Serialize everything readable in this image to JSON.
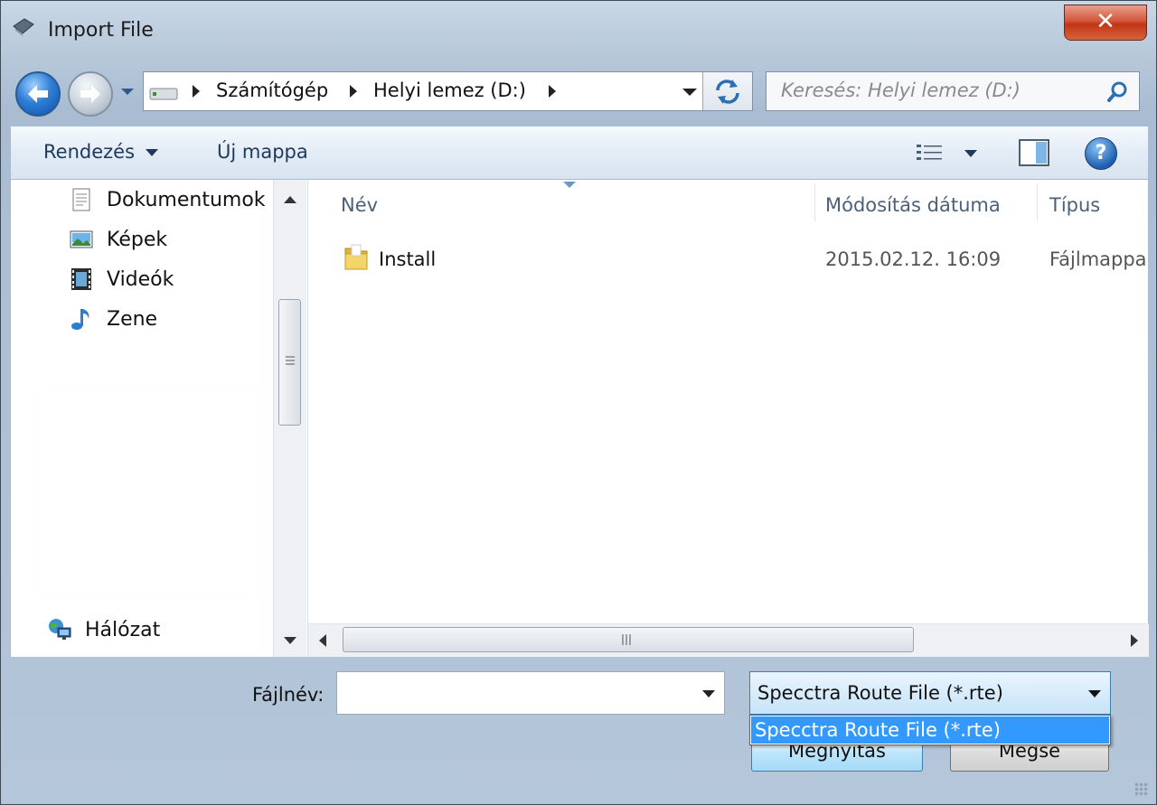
{
  "window": {
    "title": "Import File",
    "close_label": "✕"
  },
  "address": {
    "crumbs": [
      "Számítógép",
      "Helyi lemez (D:)"
    ]
  },
  "search": {
    "placeholder": "Keresés: Helyi lemez (D:)"
  },
  "toolbar": {
    "organize_label": "Rendezés",
    "new_folder_label": "Új mappa",
    "help_label": "?"
  },
  "sidebar": {
    "items": [
      {
        "label": "Dokumentumok",
        "icon": "document-icon"
      },
      {
        "label": "Képek",
        "icon": "picture-icon"
      },
      {
        "label": "Videók",
        "icon": "video-icon"
      },
      {
        "label": "Zene",
        "icon": "music-icon"
      }
    ],
    "network_label": "Hálózat"
  },
  "file_list": {
    "columns": [
      "Név",
      "Módosítás dátuma",
      "Típus"
    ],
    "rows": [
      {
        "name": "Install",
        "modified": "2015.02.12. 16:09",
        "type": "Fájlmappa",
        "icon": "folder-icon"
      }
    ]
  },
  "footer": {
    "filename_label": "Fájlnév:",
    "filename_value": "",
    "filetype_selected": "Specctra Route File (*.rte)",
    "filetype_options": [
      "Specctra Route File (*.rte)"
    ],
    "open_label": "Megnyitás",
    "cancel_label": "Mégse"
  }
}
